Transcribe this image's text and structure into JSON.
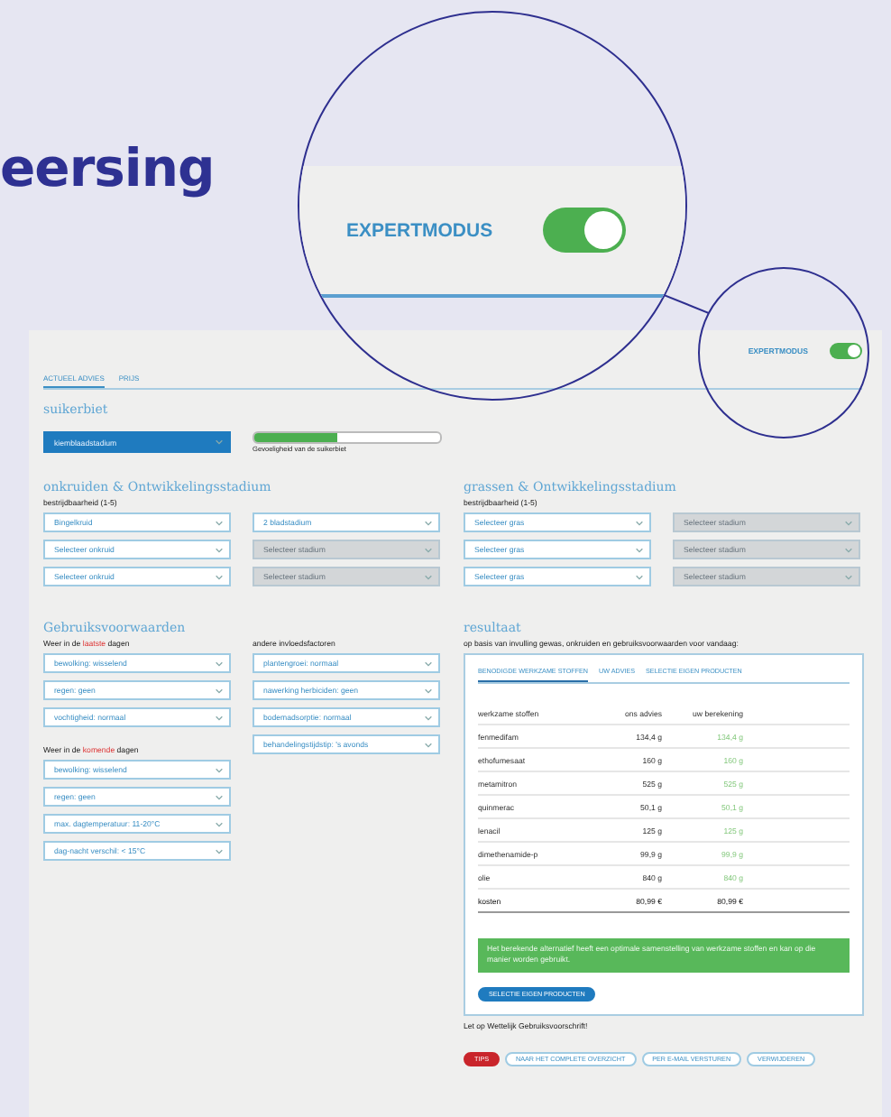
{
  "heading": "eersing",
  "magnifier": {
    "label": "EXPERTMODUS",
    "on": true
  },
  "app": {
    "expert_mode": {
      "label": "EXPERTMODUS",
      "on": true
    },
    "tabs": [
      {
        "label": "ACTUEEL ADVIES",
        "selected": true
      },
      {
        "label": "PRIJS",
        "selected": false
      }
    ],
    "crop": {
      "title": "suikerbiet",
      "stage": "kiemblaadstadium",
      "sensitivity": {
        "level": 0.45,
        "label": "Gevoeligheid van de suikerbiet"
      }
    },
    "weeds": {
      "title": "onkruiden & Ontwikkelingsstadium",
      "subtitle": "bestrijdbaarheid (1-5)",
      "rows": [
        {
          "weed": {
            "value": "Bingelkruid",
            "disabled": false
          },
          "stage": {
            "value": "2 bladstadium",
            "disabled": false
          }
        },
        {
          "weed": {
            "value": "Selecteer onkruid",
            "disabled": false
          },
          "stage": {
            "value": "Selecteer stadium",
            "disabled": true
          }
        },
        {
          "weed": {
            "value": "Selecteer onkruid",
            "disabled": false
          },
          "stage": {
            "value": "Selecteer stadium",
            "disabled": true
          }
        }
      ]
    },
    "grasses": {
      "title": "grassen & Ontwikkelingsstadium",
      "subtitle": "bestrijdbaarheid (1-5)",
      "rows": [
        {
          "weed": {
            "value": "Selecteer gras",
            "disabled": false
          },
          "stage": {
            "value": "Selecteer stadium",
            "disabled": true
          }
        },
        {
          "weed": {
            "value": "Selecteer gras",
            "disabled": false
          },
          "stage": {
            "value": "Selecteer stadium",
            "disabled": true
          }
        },
        {
          "weed": {
            "value": "Selecteer gras",
            "disabled": false
          },
          "stage": {
            "value": "Selecteer stadium",
            "disabled": true
          }
        }
      ]
    },
    "conditions": {
      "title": "Gebruiksvoorwaarden",
      "past": {
        "label": {
          "before": "Weer in de ",
          "highlight": "laatste",
          "after": " dagen"
        },
        "selects": [
          "bewolking: wisselend",
          "regen: geen",
          "vochtigheid: normaal"
        ]
      },
      "coming": {
        "label": {
          "before": "Weer in de ",
          "highlight": "komende",
          "after": " dagen"
        },
        "selects": [
          "bewolking: wisselend",
          "regen: geen",
          "max. dagtemperatuur: 11-20°C",
          "dag-nacht verschil: < 15°C"
        ]
      },
      "other": {
        "label": "andere invloedsfactoren",
        "selects": [
          "plantengroei: normaal",
          "nawerking herbiciden: geen",
          "bodemadsorptie: normaal",
          "behandelingstijdstip: 's avonds"
        ]
      }
    },
    "result": {
      "title": "resultaat",
      "intro": "op basis van invulling gewas, onkruiden en gebruiksvoorwaarden voor vandaag:",
      "tabs": [
        {
          "label": "BENODIGDE WERKZAME STOFFEN",
          "selected": true
        },
        {
          "label": "UW ADVIES",
          "selected": false
        },
        {
          "label": "SELECTIE EIGEN PRODUCTEN",
          "selected": false
        }
      ],
      "columns": [
        "werkzame stoffen",
        "ons advies",
        "uw berekening"
      ],
      "rows": [
        {
          "kind": "substance",
          "name": "fenmedifam",
          "advice": "134,4 g",
          "calc": "134,4 g"
        },
        {
          "kind": "substance",
          "name": "ethofumesaat",
          "advice": "160 g",
          "calc": "160 g"
        },
        {
          "kind": "substance",
          "name": "metamitron",
          "advice": "525 g",
          "calc": "525 g"
        },
        {
          "kind": "substance",
          "name": "quinmerac",
          "advice": "50,1 g",
          "calc": "50,1 g"
        },
        {
          "kind": "substance",
          "name": "lenacil",
          "advice": "125 g",
          "calc": "125 g"
        },
        {
          "kind": "substance",
          "name": "dimethenamide-p",
          "advice": "99,9 g",
          "calc": "99,9 g"
        },
        {
          "kind": "substance",
          "name": "olie",
          "advice": "840 g",
          "calc": "840 g"
        },
        {
          "kind": "total",
          "name": "kosten",
          "advice": "80,99 €",
          "calc": "80,99 €"
        }
      ],
      "alert": "Het berekende alternatief heeft een optimale samenstelling van werkzame stoffen en kan op die manier worden gebruikt.",
      "button": "SELECTIE EIGEN PRODUCTEN"
    },
    "notice": "Let op Wettelijk Gebruiksvoorschrift!",
    "actions": [
      {
        "label": "TIPS",
        "kind": "primary"
      },
      {
        "label": "NAAR HET COMPLETE OVERZICHT",
        "kind": "outline"
      },
      {
        "label": "PER E-MAIL VERSTUREN",
        "kind": "outline"
      },
      {
        "label": "VERWIJDEREN",
        "kind": "outline"
      }
    ]
  }
}
